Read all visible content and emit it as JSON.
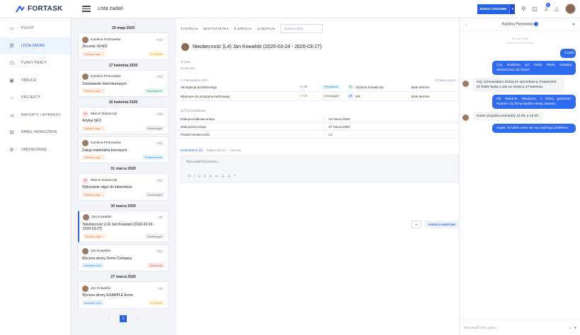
{
  "brand": {
    "name": "FORTASK"
  },
  "header": {
    "crumb": "Lista zadań",
    "add_label": "DODAJ ZADANIE",
    "add_caret": "▾",
    "notif_count": "6"
  },
  "sidebar": {
    "items": [
      {
        "label": "PULPIT",
        "icon": "monitor-icon",
        "glyph": "▭"
      },
      {
        "label": "LISTA ZADAŃ",
        "icon": "list-icon",
        "glyph": "☰"
      },
      {
        "label": "PLANY PRACY",
        "icon": "clock-icon",
        "glyph": "◷"
      },
      {
        "label": "TABLICA",
        "icon": "board-icon",
        "glyph": "▣"
      },
      {
        "label": "PROJEKTY",
        "icon": "briefcase-icon",
        "glyph": "⌂"
      },
      {
        "label": "RAPORTY I WYKRESY",
        "icon": "chart-icon",
        "glyph": "⊿"
      },
      {
        "label": "PANEL MENEDŻERA",
        "icon": "manager-icon",
        "glyph": "▤"
      },
      {
        "label": "ZARZĄDZANIE",
        "icon": "gear-icon",
        "glyph": "⚙"
      }
    ]
  },
  "groups": [
    {
      "date": "20 maja 2020",
      "cards": [
        {
          "user": "Karolina Piotrowska",
          "ini": "",
          "id": "#12",
          "title": "Zlecenie 42/402",
          "left": "Sprawy orga...",
          "right": "W trakcie",
          "rc": "#e2a000",
          "rbg": "#fff4dc"
        }
      ]
    },
    {
      "date": "17 kwietnia 2020",
      "cards": [
        {
          "user": "Karolina Piotrowska",
          "ini": "",
          "id": "#11",
          "title": "Zamówienie foteli biurowych",
          "left": "Sprawy orga...",
          "right": "Rozwiązane",
          "rc": "#2e9e6a",
          "rbg": "#e2f6ec"
        }
      ]
    },
    {
      "date": "16 kwietnia 2020",
      "cards": [
        {
          "user": "Marcin Nowaczyk",
          "ini": "MN",
          "id": "#15",
          "title": "Artykuł SEO",
          "left": "Sprawy orga...",
          "right": "Oczekujące",
          "rc": "#666",
          "rbg": "#f0f0f0"
        },
        {
          "user": "Karolina Piotrowska",
          "ini": "",
          "id": "#10",
          "title": "Zakup materiałów biurowych",
          "left": "Sprawy orga...",
          "right": "Potwierdzone",
          "rc": "#2a8bd0",
          "rbg": "#e2f1fb"
        }
      ]
    },
    {
      "date": "31 marca 2020",
      "cards": [
        {
          "user": "Marcin Nowaczyk",
          "ini": "MN",
          "id": "#14",
          "title": "Wykonanie zdjęć do kalendarza",
          "left": "Sprawy orga...",
          "right": "Oczekujące",
          "rc": "#666",
          "rbg": "#f0f0f0"
        }
      ]
    },
    {
      "date": "30 marca 2020",
      "cards": [
        {
          "user": "Jan Kowalski",
          "ini": "",
          "id": "#9",
          "title": "Nieobecność (L4) Jan Kowalski (2020-03-24 - 2020-03-27)",
          "left": "Sprawy orga...",
          "right": "Oczekujące",
          "rc": "#666",
          "rbg": "#f0f0f0",
          "sel": true
        },
        {
          "user": "Jan Kowalski",
          "ini": "",
          "id": "#13",
          "title": "Wycena strony Demo Company",
          "left": "example.com",
          "right": "Zwrócona",
          "rc": "#e04848",
          "rbg": "#fde6e6"
        }
      ]
    },
    {
      "date": "27 marca 2020",
      "cards": [
        {
          "user": "Jan Kowalski",
          "ini": "",
          "id": "#8",
          "title": "Wycena strony EXAMPLE Acme",
          "left": "example.com",
          "right": "W trakcie",
          "rc": "#e2a000",
          "rbg": "#fff4dc"
        }
      ]
    }
  ],
  "pagination": {
    "prev": "‹",
    "page": "1",
    "next": "›"
  },
  "toolbar": {
    "filter": "FILTRUJ",
    "load": "WCZYTAJ FILTR",
    "sort": "SORTUJ",
    "group": "GRUPUJ",
    "search_ph": "Szukana fraza"
  },
  "detail": {
    "title": "Nieobecność (L4) Jan Kowalski (2020-03-24 - 2020-03-27)",
    "desc_label": "Opis",
    "desc_ph": "Dodaj opis...",
    "sub_label": "Podzadania (0/2)",
    "show_done": "Pokaż wszys",
    "subtasks": [
      {
        "name": "Akceptacja przełożonego",
        "ic": "◷ ⊡0",
        "status": "Przypisane",
        "sc": "#2a8bd0",
        "sbg": "#e2f1fb",
        "ini": "SK",
        "ic2": "#2e9e6a",
        "ibg": "#def3e8",
        "user": "Szymon Kowalczyk",
        "due": "Brak terminu"
      },
      {
        "name": "Wpisanie do programu kadrowego",
        "ic": "◷ ⊡0",
        "status": "Oczekujące",
        "sc": "#666",
        "sbg": "#f0f0f0",
        "ini": "HR",
        "ic2": "#2563eb",
        "ibg": "#e2eafd",
        "user": "HR",
        "due": "Brak terminu"
      }
    ],
    "extra_label": "Pola dodatkowe",
    "fields": [
      {
        "label": "Data początkowa urlopu",
        "value": "24 marca 2020"
      },
      {
        "label": "Data końca urlopu",
        "value": "27 marca 2020"
      },
      {
        "label": "Powód nieobecności",
        "value": "L4"
      }
    ],
    "tabs": [
      "Komentarze (0)",
      "Załączniki (0)",
      "Historia"
    ],
    "comment_ph": "Wprowadź komentarz...",
    "tools": "B I U S ≣ ≣ ☰ ☰ ❞",
    "send": "DODAJ KOMENTAR"
  },
  "chat": {
    "name": "Karolina Piotrowska",
    "dot": "i",
    "date": "20 mar 2020",
    "start": "(Utworzenie konwersacji)",
    "msgs": [
      {
        "me": true,
        "t": "Cześć"
      },
      {
        "me": true,
        "t": "Czy wiadomo już kiedy fotele zostaną dostarczone do biura?"
      },
      {
        "me": false,
        "t": "Hej, rozmawiałam dzisiaj ze sprzedawcą. Potwierdził, że fotele będą u nas na miejscu 27 kwietnia."
      },
      {
        "me": true,
        "t": "Ok, świetnie. Wiadomo, o której godzinie? Pytanie czy firma będzie wtedy otwarta."
      },
      {
        "me": false,
        "t": "Kurier przyjdzie pomiędzy 12.00, a 15.30."
      },
      {
        "me": true,
        "t": "Super. W takim razie nie ma żadnego problemu."
      }
    ],
    "input_ph": "Wprowadź treść wpisu..."
  }
}
